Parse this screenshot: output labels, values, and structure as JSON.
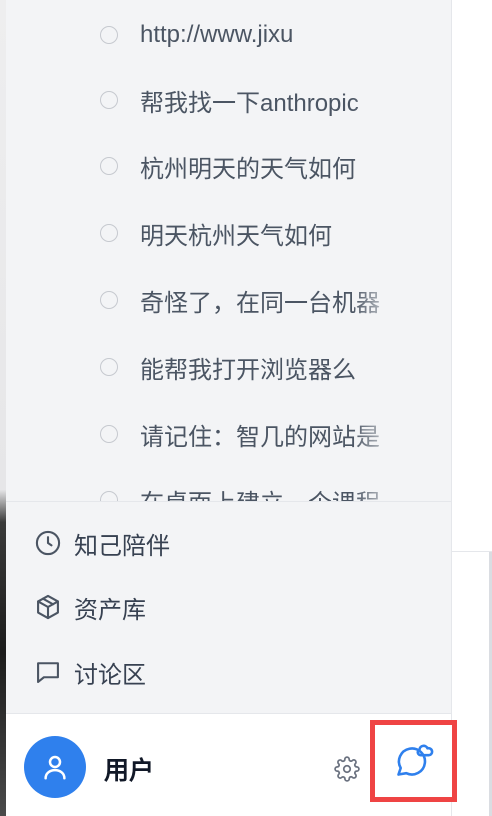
{
  "history": {
    "items": [
      {
        "label": "http://www.jixu"
      },
      {
        "label": "帮我找一下anthropic"
      },
      {
        "label": "杭州明天的天气如何"
      },
      {
        "label": "明天杭州天气如何"
      },
      {
        "label": "奇怪了，在同一台机器"
      },
      {
        "label": "能帮我打开浏览器么"
      },
      {
        "label": "请记住：智几的网站是"
      },
      {
        "label": "在桌面上建立一个课程"
      }
    ]
  },
  "nav": {
    "items": [
      {
        "label": "知己陪伴",
        "icon": "clock-icon"
      },
      {
        "label": "资产库",
        "icon": "cube-icon"
      },
      {
        "label": "讨论区",
        "icon": "message-square-icon"
      }
    ]
  },
  "footer": {
    "username": "用户",
    "avatar_icon": "user-icon",
    "settings_icon": "gear-icon",
    "chat_icon": "chat-bubble-icon"
  },
  "colors": {
    "accent": "#2f80ed",
    "highlight_border": "#ef4444",
    "sidebar_bg": "#f3f4f6"
  }
}
